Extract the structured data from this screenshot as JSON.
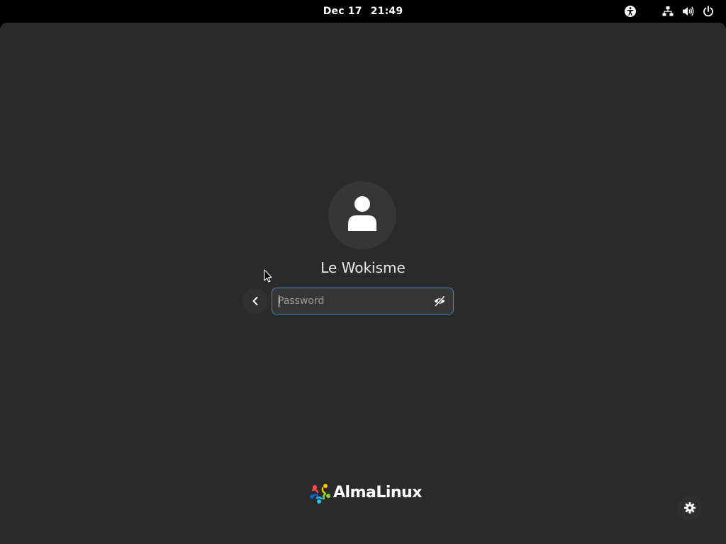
{
  "topbar": {
    "date": "Dec 17",
    "time": "21:49",
    "icons": [
      "accessibility-icon",
      "network-icon",
      "volume-icon",
      "power-icon"
    ]
  },
  "login": {
    "username": "Le Wokisme",
    "password_placeholder": "Password",
    "password_value": "",
    "avatar_icon": "user-icon",
    "back_icon": "chevron-left-icon",
    "reveal_icon": "eye-hidden-icon"
  },
  "branding": {
    "logo_text": "AlmaLinux",
    "logo_colors": [
      "#ff4649",
      "#ffc702",
      "#86da2f",
      "#24c2ff",
      "#0069da"
    ]
  },
  "footer": {
    "settings_icon": "gear-icon"
  },
  "colors": {
    "background": "#2a2a2a",
    "topbar": "#000000",
    "accent": "#3584e4"
  }
}
